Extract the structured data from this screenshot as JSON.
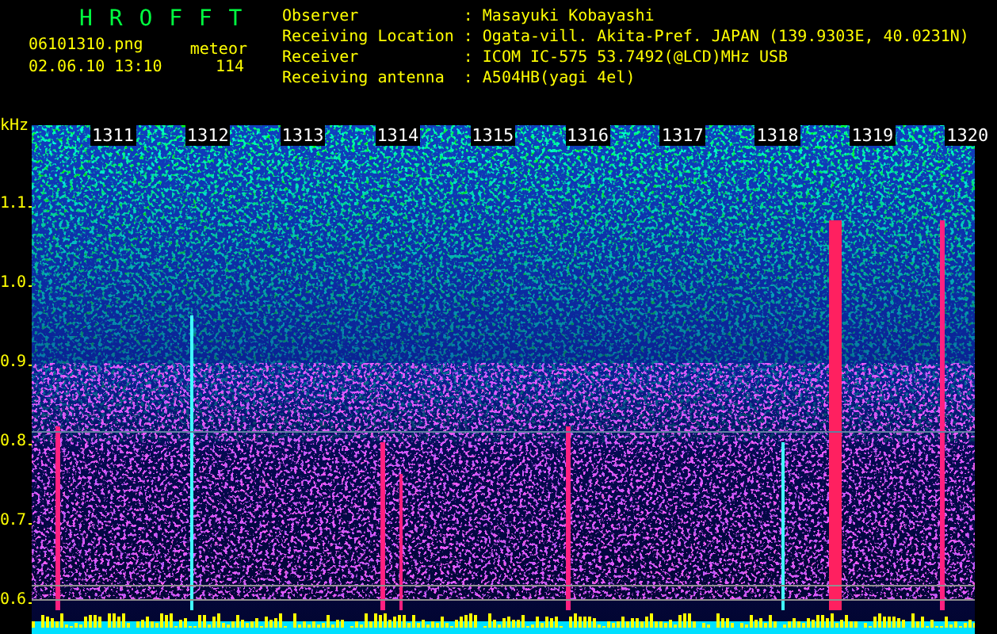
{
  "app_title": "H R O F F T",
  "file_name": "06101310.png",
  "datetime": "02.06.10 13:10",
  "counter": {
    "label": "meteor",
    "value": "114"
  },
  "station_info": [
    {
      "label": "Observer",
      "separator": ":",
      "value": "Masayuki Kobayashi"
    },
    {
      "label": "Receiving Location",
      "separator": ":",
      "value": "Ogata-vill. Akita-Pref. JAPAN (139.9303E, 40.0231N)"
    },
    {
      "label": "Receiver",
      "separator": ":",
      "value": "ICOM IC-575 53.7492(@LCD)MHz USB"
    },
    {
      "label": "Receiving antenna",
      "separator": ":",
      "value": "A504HB(yagi 4el)"
    }
  ],
  "spectrogram": {
    "unit": "kHz",
    "y_labels": [
      "1.1",
      "1.0",
      "0.9",
      "0.8",
      "0.7",
      "0.6"
    ],
    "time_labels": [
      "1311",
      "1312",
      "1313",
      "1314",
      "1315",
      "1316",
      "1317",
      "1318",
      "1319",
      "1320"
    ]
  }
}
